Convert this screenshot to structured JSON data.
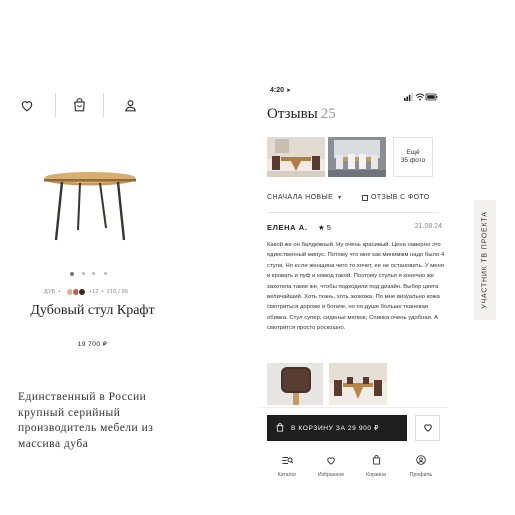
{
  "left": {
    "icons": [
      "heart-icon",
      "bag-icon",
      "user-icon"
    ],
    "meta_material": "ДУБ",
    "meta_colors_more": "+12",
    "meta_size": "210 / 95",
    "product_title": "Дубовый стул Крафт",
    "product_price": "19 700 ₽",
    "tagline": "Единственный в России крупный серийный производитель мебели из массива дуба"
  },
  "phone": {
    "time": "4:20",
    "reviews_title": "Отзывы",
    "reviews_count": "25",
    "more_photos_line1": "Ещё",
    "more_photos_line2": "35 фото",
    "sort_label": "СНАЧАЛА НОВЫЕ",
    "filter_label": "ОТЗЫВ С ФОТО",
    "review": {
      "author": "ЕЛЕНА А.",
      "rating": "★ 5",
      "date": "21.08.24",
      "text": "Какой же он балдежный. Ну очень красивый. Цена наверно это единственный минус. Потому что мне как минимжм надо было 4 стула. Но если женщина чего то хочет, ее не остановить. У меня и кровать и пуф и комод такой. Поэтому стулья я конечно же захотела такие же, чтобы подходили под дизайн. Выбор цвета величайший. Хоть ткань, хоть экокожа. По мне визуально кожа смотриться дороже и богаче, но по душе больше тканевая обивка. Стул супер, сиденье мягкое, Спинка очень удобная. А смотрится просто роскошно."
    },
    "cart_label": "В КОРЗИНУ ЗА 29 900 ₽",
    "tabs": [
      {
        "icon": "catalog-icon",
        "label": "Каталог"
      },
      {
        "icon": "heart-icon",
        "label": "Избранное"
      },
      {
        "icon": "bag-icon",
        "label": "Корзина"
      },
      {
        "icon": "profile-icon",
        "label": "Профиль"
      }
    ]
  },
  "side_badge": "УЧАСТНИК ТВ ПРОЕКТА",
  "colors": {
    "accent_dark": "#1e1e1e",
    "wood": "#c79a5d",
    "leg": "#3a3330",
    "badge_bg": "#f3f1f0"
  }
}
